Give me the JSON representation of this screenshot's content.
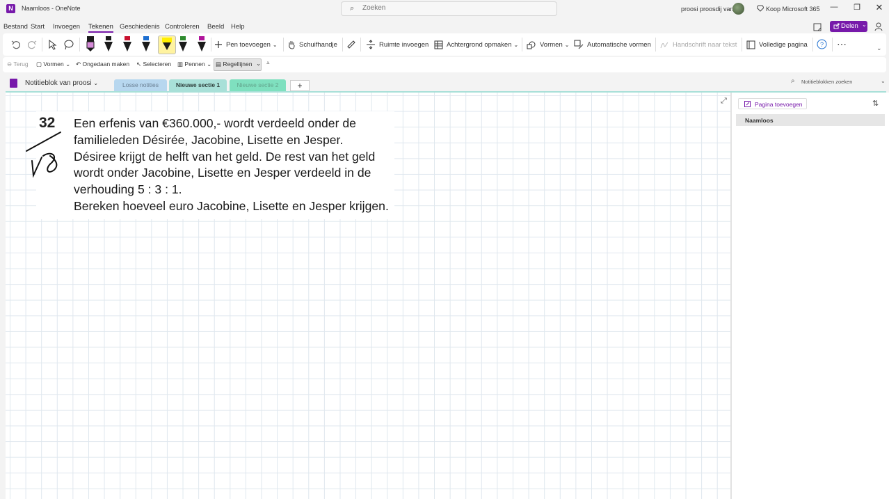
{
  "window": {
    "app_logo": "N",
    "title": "Naamloos  -  OneNote",
    "search_placeholder": "Zoeken",
    "user_name": "proosi proosdij van",
    "buy_label": "Koop Microsoft 365"
  },
  "menu": {
    "items": [
      "Bestand",
      "Start",
      "Invoegen",
      "Tekenen",
      "Geschiedenis",
      "Controleren",
      "Beeld",
      "Help"
    ],
    "active": "Tekenen",
    "share_label": "Delen"
  },
  "ribbon": {
    "pens": [
      {
        "color": "#1b1b1b",
        "tip": "#d58bd8"
      },
      {
        "color": "#1b1b1b",
        "tip": "#1b1b1b"
      },
      {
        "color": "#1b1b1b",
        "tip": "#c8102e"
      },
      {
        "color": "#1b1b1b",
        "tip": "#1e6fd0"
      },
      {
        "color": "#1b1b1b",
        "tip": "#ffef00"
      },
      {
        "color": "#1b1b1b",
        "tip": "#2e8b2e"
      },
      {
        "color": "#1b1b1b",
        "tip": "#b0149b"
      }
    ],
    "selected_pen": 4,
    "pen_toevoegen": "Pen toevoegen",
    "schuifhandje": "Schuifhandje",
    "ruimte_invoegen": "Ruimte invoegen",
    "achtergrond_opmaken": "Achtergrond opmaken",
    "vormen": "Vormen",
    "automatische_vormen": "Automatische vormen",
    "handschrift_naar_tekst": "Handschrift naar tekst",
    "volledige_pagina": "Volledige pagina"
  },
  "subbar": {
    "terug": "Terug",
    "vormen": "Vormen",
    "ongedaan_maken": "Ongedaan maken",
    "selecteren": "Selecteren",
    "pennen": "Pennen",
    "regellijnen": "Regellijnen"
  },
  "notebook": {
    "name": "Notitieblok van proosi",
    "sections": [
      "Losse notities",
      "Nieuwe sectie 1",
      "Nieuwe sectie 2"
    ],
    "active_section": "Nieuwe sectie 1",
    "add_section": "+",
    "search_placeholder": "Notitieblokken zoeken"
  },
  "page": {
    "exercise_number": "32",
    "problem_lines": [
      "Een erfenis van €360.000,- wordt verdeeld onder de",
      "familieleden Désirée, Jacobine, Lisette en Jesper.",
      "Désiree krijgt de helft van het geld. De rest van het geld",
      "wordt onder Jacobine, Lisette en Jesper verdeeld in de",
      "verhouding 5 : 3 : 1.",
      "Bereken hoeveel euro Jacobine, Lisette en Jesper krijgen."
    ]
  },
  "pages_panel": {
    "add_page": "Pagina toevoegen",
    "pages": [
      "Naamloos"
    ]
  },
  "colors": {
    "accent": "#7719aa",
    "section_active": "#a8e0d8",
    "section_losse": "#b7d7ef",
    "section_2": "#7fe0bf"
  }
}
